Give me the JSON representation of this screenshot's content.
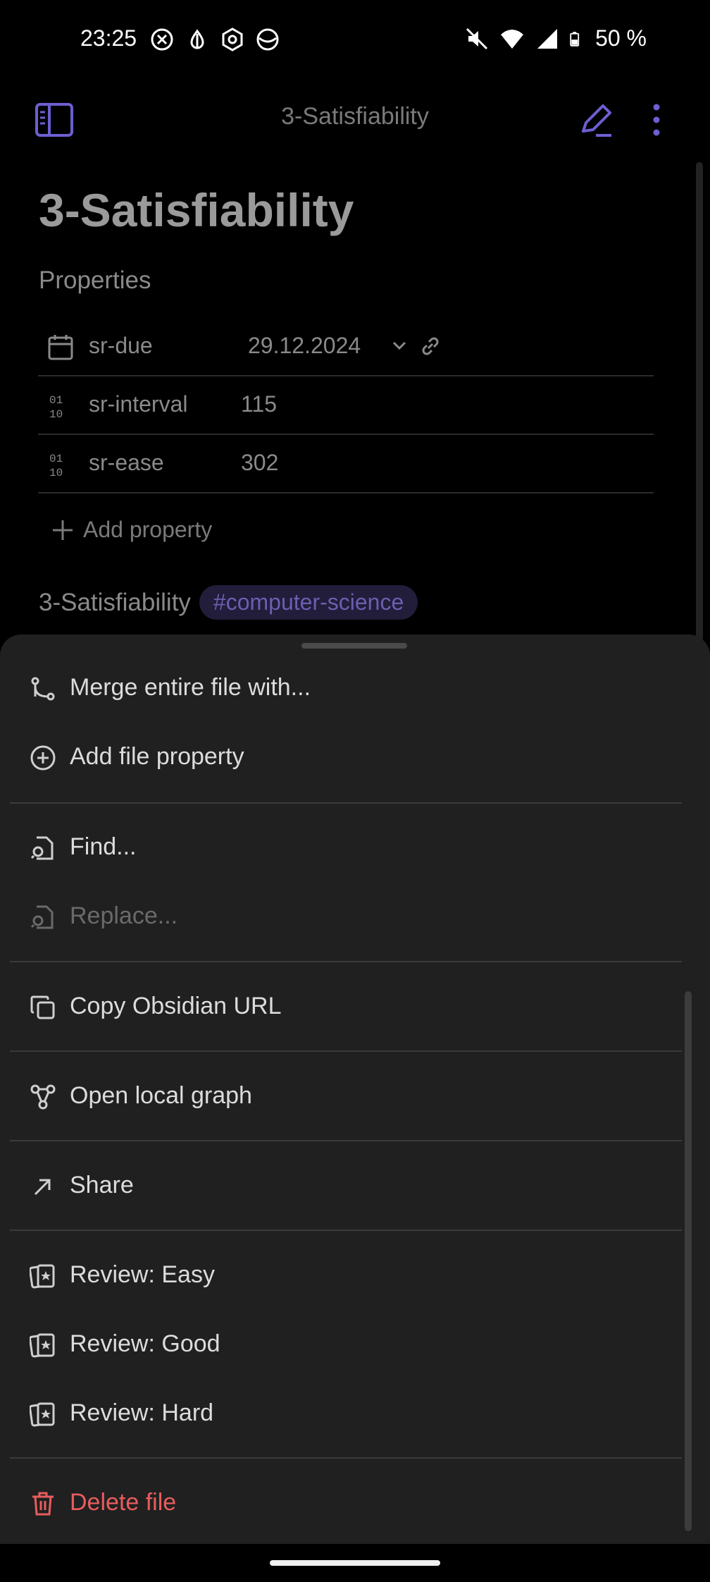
{
  "status_bar": {
    "time": "23:25",
    "left_icons": [
      "vpn-icon",
      "data-saver-icon",
      "app-icon",
      "sync-icon"
    ],
    "right_icons": [
      "mute-icon",
      "wifi-icon",
      "signal-icon",
      "battery-icon"
    ],
    "battery": "50 %"
  },
  "header": {
    "title": "3-Satisfiability",
    "accent_color": "#6c5fd0"
  },
  "note": {
    "title": "3-Satisfiability",
    "properties_label": "Properties",
    "properties": [
      {
        "icon": "calendar-icon",
        "key": "sr-due",
        "value": "29.12.2024"
      },
      {
        "icon": "number-icon",
        "key": "sr-interval",
        "value": "115"
      },
      {
        "icon": "number-icon",
        "key": "sr-ease",
        "value": "302"
      }
    ],
    "add_property_label": "Add property",
    "body_text": "3-Satisfiability",
    "tag": "#computer-science"
  },
  "menu": {
    "items": [
      {
        "icon": "merge-icon",
        "label": "Merge entire file with..."
      },
      {
        "icon": "add-circle-icon",
        "label": "Add file property"
      },
      {
        "icon": "find-icon",
        "label": "Find..."
      },
      {
        "icon": "replace-icon",
        "label": "Replace...",
        "disabled": true
      },
      {
        "icon": "copy-icon",
        "label": "Copy Obsidian URL"
      },
      {
        "icon": "graph-icon",
        "label": "Open local graph"
      },
      {
        "icon": "share-icon",
        "label": "Share"
      },
      {
        "icon": "flashcard-icon",
        "label": "Review: Easy"
      },
      {
        "icon": "flashcard-icon",
        "label": "Review: Good"
      },
      {
        "icon": "flashcard-icon",
        "label": "Review: Hard"
      },
      {
        "icon": "trash-icon",
        "label": "Delete file",
        "danger": true
      }
    ],
    "danger_color": "#e85d5d"
  }
}
